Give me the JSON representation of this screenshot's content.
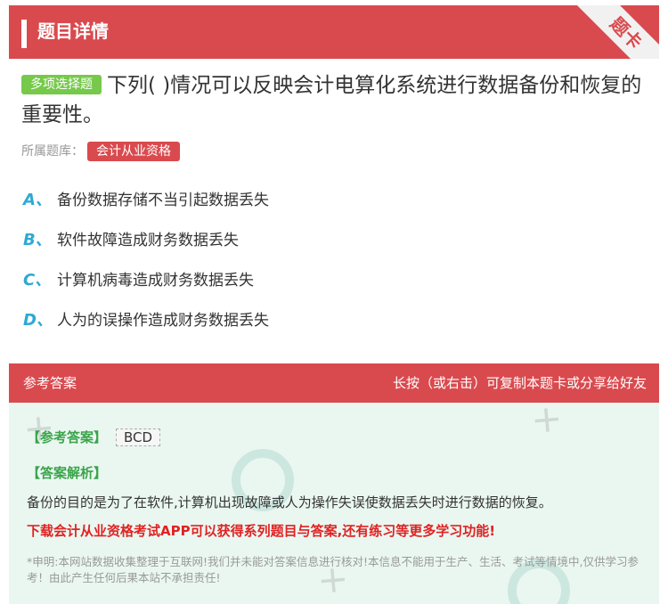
{
  "header": {
    "title": "题目详情",
    "corner_label": "题卡"
  },
  "question": {
    "type_label": "多项选择题",
    "text": "下列( )情况可以反映会计电算化系统进行数据备份和恢复的重要性。",
    "bank_label": "所属题库：",
    "bank_name": "会计从业资格"
  },
  "options": [
    {
      "letter": "A、",
      "text": "备份数据存储不当引起数据丢失"
    },
    {
      "letter": "B、",
      "text": "软件故障造成财务数据丢失"
    },
    {
      "letter": "C、",
      "text": "计算机病毒造成财务数据丢失"
    },
    {
      "letter": "D、",
      "text": "人为的误操作造成财务数据丢失"
    }
  ],
  "answer_section": {
    "header_left": "参考答案",
    "header_right": "长按（或右击）可复制本题卡或分享给好友",
    "answer_label": "【参考答案】",
    "answer_value": "BCD",
    "analysis_label": "【答案解析】",
    "analysis_text": "备份的目的是为了在软件,计算机出现故障或人为操作失误使数据丢失时进行数据的恢复。",
    "promo_text": "下载会计从业资格考试APP可以获得系列题目与答案,还有练习等更多学习功能!",
    "disclaimer": "*申明:本网站数据收集整理于互联网!我们并未能对答案信息进行核对!本信息不能用于生产、生活、考试等情境中,仅供学习参考！由此产生任何后果本站不承担责任!"
  },
  "colors": {
    "brand_red": "#d94a4e",
    "tag_green": "#76c94a",
    "option_letter_blue": "#2fa9d3",
    "answer_bg": "#eaf7f1",
    "promo_red": "#e02222"
  }
}
